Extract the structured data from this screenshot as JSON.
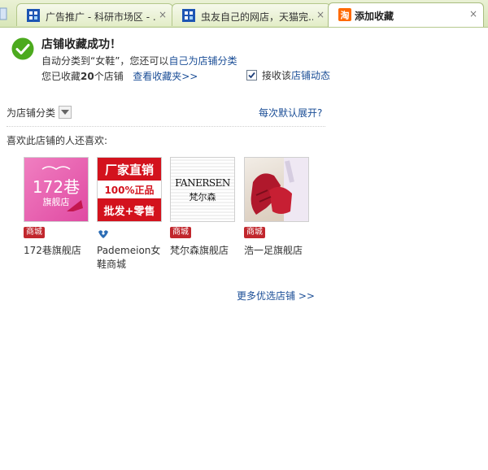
{
  "tabs": [
    {
      "label": "广告推广 - 科研市场区 - ...",
      "close": "×"
    },
    {
      "label": "虫友自己的网店，天猫完...",
      "close": "×"
    },
    {
      "label": "添加收藏",
      "close": "×"
    }
  ],
  "success": {
    "title": "店铺收藏成功！",
    "auto_prefix": "自动分类到“女鞋”，您还可以",
    "auto_link": "自己为店铺分类",
    "count_prefix": "您已收藏",
    "count": "20",
    "count_suffix": "个店铺",
    "view_link": "查看收藏夹>>",
    "subscribe_prefix": "接收该",
    "subscribe_link": "店铺动态"
  },
  "category": {
    "label": "为店铺分类",
    "expand_link": "每次默认展开?"
  },
  "recommend": {
    "heading": "喜欢此店铺的人还喜欢:",
    "stores": [
      {
        "name": "172巷旗舰店",
        "badge": "商城",
        "thumb_main": "172巷",
        "thumb_sub": "旗舰店"
      },
      {
        "name": "Pademeion女鞋商城",
        "badge_icon": "bird-icon",
        "thumb_lines": [
          "厂家直销",
          "100%正品",
          "批发+零售"
        ]
      },
      {
        "name": "梵尔森旗舰店",
        "badge": "商城",
        "thumb_main": "FANERSEN",
        "thumb_sub": "梵尔森"
      },
      {
        "name": "浩一足旗舰店",
        "badge": "商城"
      }
    ],
    "more_link": "更多优选店铺 >>"
  },
  "colors": {
    "accent_link": "#1a4d96",
    "badge_red": "#c1272d",
    "success_green": "#4caa1e"
  }
}
